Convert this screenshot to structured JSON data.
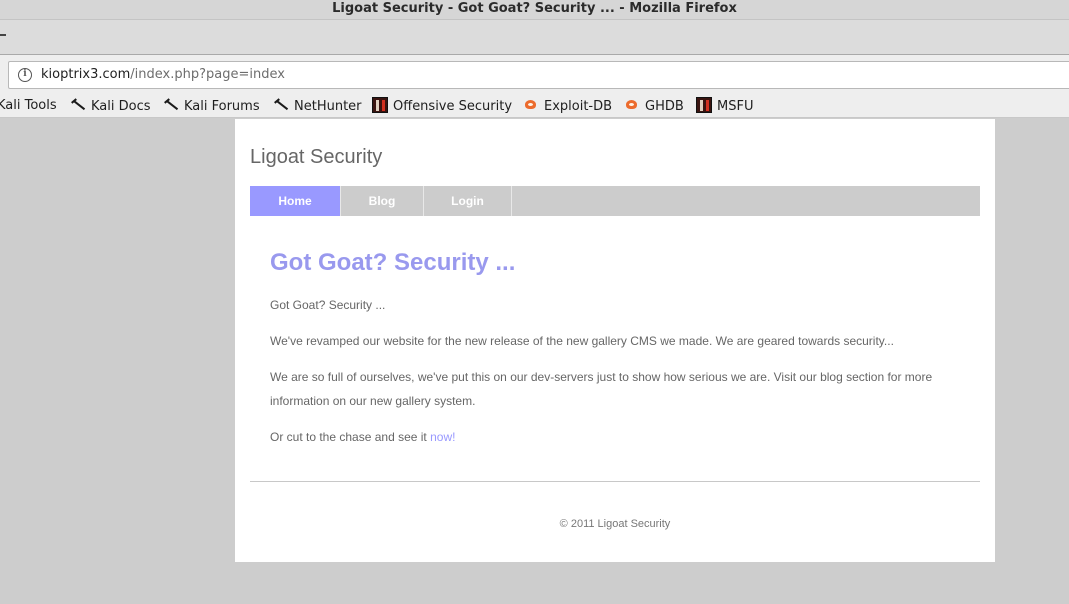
{
  "window": {
    "title": "Ligoat Security - Got Goat? Security ... - Mozilla Firefox"
  },
  "urlbar": {
    "host": "kioptrix3.com",
    "path": "/index.php?page=index"
  },
  "bookmarks": [
    {
      "label": "Kali Tools",
      "icon": "kali-icon"
    },
    {
      "label": "Kali Docs",
      "icon": "kali-icon"
    },
    {
      "label": "Kali Forums",
      "icon": "kali-icon"
    },
    {
      "label": "NetHunter",
      "icon": "kali-icon"
    },
    {
      "label": "Offensive Security",
      "icon": "offsec-icon"
    },
    {
      "label": "Exploit-DB",
      "icon": "exploit-db-icon"
    },
    {
      "label": "GHDB",
      "icon": "exploit-db-icon"
    },
    {
      "label": "MSFU",
      "icon": "offsec-icon"
    }
  ],
  "site": {
    "title": "Ligoat Security",
    "nav": [
      "Home",
      "Blog",
      "Login"
    ],
    "active_nav": "Home",
    "headline": "Got Goat? Security ...",
    "paragraphs": {
      "p1": "Got Goat? Security ...",
      "p2": "We've revamped our website for the new release of the new gallery CMS we made. We are geared towards security...",
      "p3": "We are so full of ourselves, we've put this on our dev-servers just to show how serious we are. Visit our blog section for more information on our new gallery system.",
      "p4_text": "Or cut to the chase and see it ",
      "p4_link": "now!"
    },
    "footer": "© 2011 Ligoat Security"
  },
  "colors": {
    "accent": "#9999ff",
    "menu_bg": "#cccccc",
    "page_bg": "#cdcdcd"
  }
}
